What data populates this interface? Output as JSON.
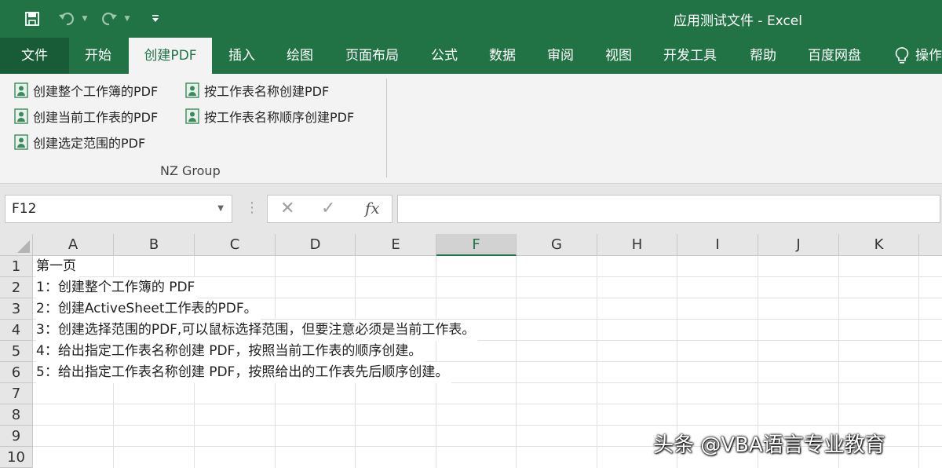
{
  "title_bar": {
    "title": "应用测试文件  -  Excel"
  },
  "tabs": [
    "文件",
    "开始",
    "创建PDF",
    "插入",
    "绘图",
    "页面布局",
    "公式",
    "数据",
    "审阅",
    "视图",
    "开发工具",
    "帮助",
    "百度网盘",
    "操作"
  ],
  "ribbon": {
    "buttons": [
      "创建整个工作簿的PDF",
      "按工作表名称创建PDF",
      "创建当前工作表的PDF",
      "按工作表名称顺序创建PDF",
      "创建选定范围的PDF"
    ],
    "group_label": "NZ Group"
  },
  "formula_bar": {
    "name_box": "F12",
    "formula": ""
  },
  "grid": {
    "columns": [
      "A",
      "B",
      "C",
      "D",
      "E",
      "F",
      "G",
      "H",
      "I",
      "J",
      "K"
    ],
    "rows": [
      "1",
      "2",
      "3",
      "4",
      "5",
      "6",
      "7",
      "8",
      "9",
      "10"
    ],
    "cells": [
      "第一页",
      "1：创建整个工作簿的 PDF",
      "2：创建ActiveSheet工作表的PDF。",
      "3：创建选择范围的PDF,可以鼠标选择范围，但要注意必须是当前工作表。",
      "4：给出指定工作表名称创建 PDF，按照当前工作表的顺序创建。",
      "5：给出指定工作表名称创建 PDF，按照给出的工作表先后顺序创建。"
    ]
  },
  "watermark": "头条 @VBA语言专业教育"
}
